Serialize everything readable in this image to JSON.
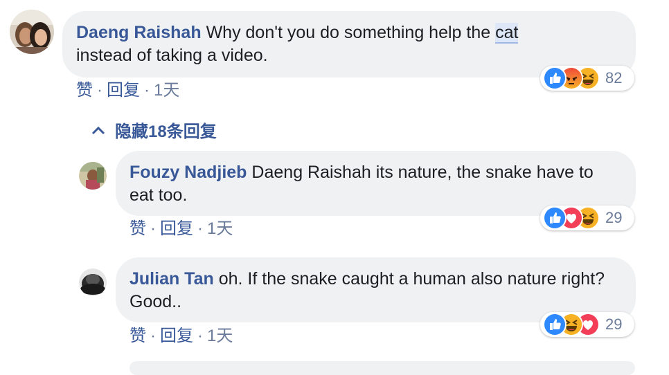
{
  "comments": [
    {
      "author": "Daeng Raishah",
      "text_before": "Why don't you do something help the ",
      "text_highlight": "cat",
      "text_after": "instead of taking a video.",
      "actions": {
        "like": "赞",
        "reply": "回复",
        "time": "1天",
        "sep": "·"
      },
      "reactions": {
        "icons": [
          "like-icon",
          "angry-icon",
          "haha-icon"
        ],
        "count": "82"
      }
    }
  ],
  "hide_replies_label": "隐藏18条回复",
  "replies": [
    {
      "author": "Fouzy Nadjieb",
      "text": "Daeng Raishah its nature, the snake have to eat too.",
      "actions": {
        "like": "赞",
        "reply": "回复",
        "time": "1天",
        "sep": "·"
      },
      "reactions": {
        "icons": [
          "like-icon",
          "love-icon",
          "haha-icon"
        ],
        "count": "29"
      }
    },
    {
      "author": "Julian Tan",
      "text": "oh. If the snake caught a human also nature right? Good..",
      "actions": {
        "like": "赞",
        "reply": "回复",
        "time": "1天",
        "sep": "·"
      },
      "reactions": {
        "icons": [
          "like-icon",
          "haha-icon",
          "love-icon"
        ],
        "count": "29"
      }
    }
  ],
  "colors": {
    "link": "#385898",
    "bubble": "#f0f1f3",
    "like": "#2e89ff",
    "love": "#f33e58",
    "haha": "#f7b125",
    "angry": "#e9710f"
  }
}
